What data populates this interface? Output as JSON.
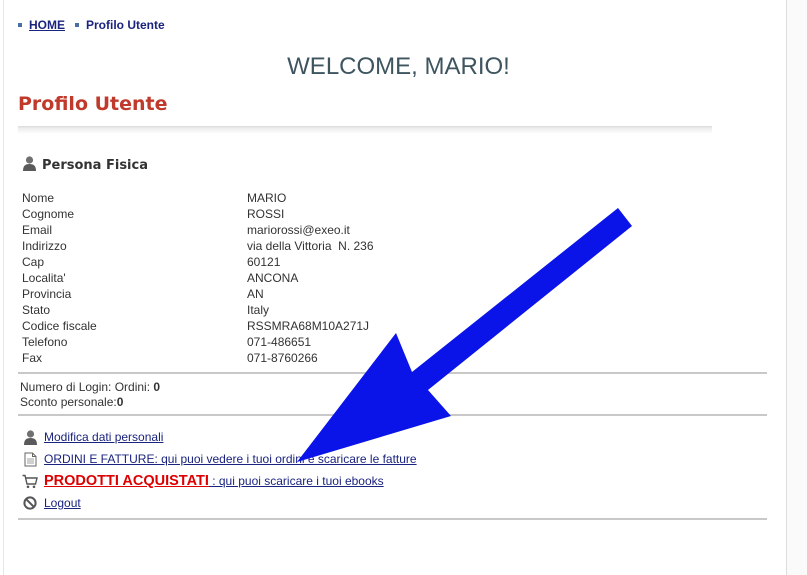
{
  "breadcrumb": {
    "home": "HOME",
    "current": "Profilo Utente"
  },
  "welcome": "WELCOME, MARIO!",
  "page_title": "Profilo Utente",
  "section_title": "Persona Fisica",
  "fields": [
    {
      "label": "Nome",
      "value": "MARIO"
    },
    {
      "label": "Cognome",
      "value": "ROSSI"
    },
    {
      "label": "Email",
      "value": "mariorossi@exeo.it"
    },
    {
      "label": "Indirizzo",
      "value": "via della Vittoria  N. 236"
    },
    {
      "label": "Cap",
      "value": "60121"
    },
    {
      "label": "Localita'",
      "value": "ANCONA"
    },
    {
      "label": "Provincia",
      "value": "AN"
    },
    {
      "label": "Stato",
      "value": "Italy"
    },
    {
      "label": "Codice fiscale",
      "value": "RSSMRA68M10A271J"
    },
    {
      "label": "Telefono",
      "value": "071-486651"
    },
    {
      "label": "Fax",
      "value": "071-8760266"
    }
  ],
  "stats": {
    "login_label": "Numero di Login: Ordini: ",
    "login_value": "0",
    "discount_label": "Sconto personale:",
    "discount_value": "0"
  },
  "links": {
    "edit": "Modifica dati personali",
    "orders": "ORDINI E FATTURE: qui puoi vedere i tuoi ordini e scaricare le fatture",
    "products_main": "PRODOTTI ACQUISTATI",
    "products_sub": " : qui puoi scaricare i tuoi ebooks",
    "logout": "Logout"
  },
  "icons": [
    "user-icon",
    "document-icon",
    "cart-icon",
    "logout-icon",
    "arrow-annotation"
  ],
  "colors": {
    "title_red": "#c0392b",
    "link_blue": "#1a237e",
    "product_red": "#dd0000",
    "arrow_blue": "#0a14e8",
    "welcome": "#3e5560"
  }
}
